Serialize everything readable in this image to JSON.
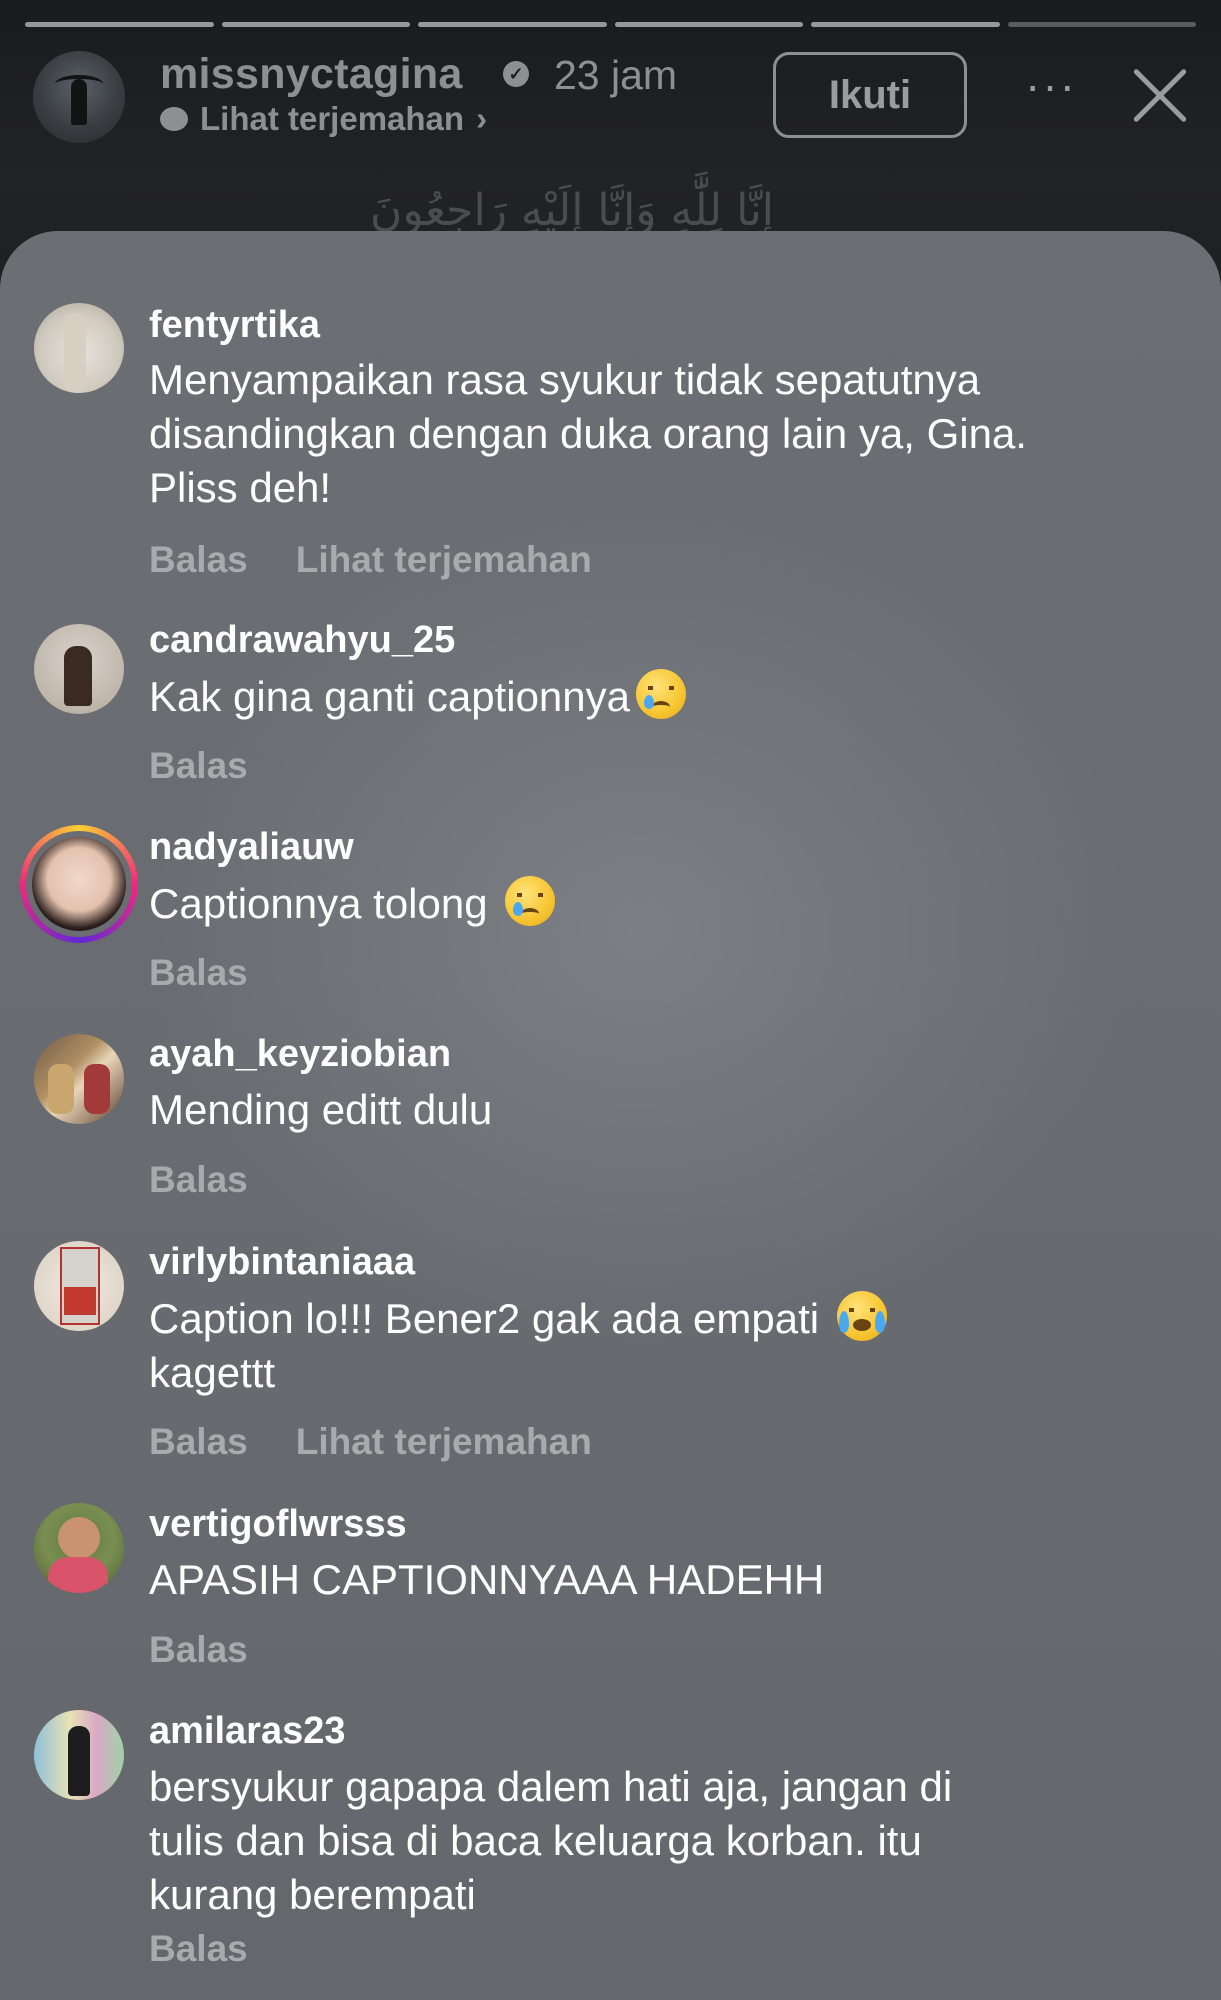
{
  "story": {
    "username": "missnyctagina",
    "time": "23 jam",
    "translate_label": "Lihat terjemahan",
    "follow_label": "Ikuti",
    "more_label": "···",
    "caption_arabic": "إِنَّا لِلَّٰهِ وَإِنَّا إِلَيْهِ رَاجِعُونَ",
    "progress_segments": 6
  },
  "comments": [
    {
      "username": "fentyrtika",
      "text": "Menyampaikan rasa syukur tidak sepatutnya disandingkan dengan duka orang lain ya, Gina. Pliss deh!",
      "reply": "Balas",
      "translate": "Lihat terjemahan"
    },
    {
      "username": "candrawahyu_25",
      "text": "Kak gina ganti captionnya",
      "emoji": "crying-face",
      "reply": "Balas"
    },
    {
      "username": "nadyaliauw",
      "text": "Captionnya tolong ",
      "emoji": "crying-face",
      "reply": "Balas"
    },
    {
      "username": "ayah_keyziobian",
      "text": "Mending editt dulu",
      "reply": "Balas"
    },
    {
      "username": "virlybintaniaaa",
      "text": "Caption lo!!! Bener2 gak ada empati ",
      "text2": "kagettt",
      "emoji": "loudly-crying-face",
      "reply": "Balas",
      "translate": "Lihat terjemahan"
    },
    {
      "username": "vertigoflwrsss",
      "text": "APASIH CAPTIONNYAAA HADEHH",
      "reply": "Balas"
    },
    {
      "username": "amilaras23",
      "text": "bersyukur gapapa dalem hati aja, jangan di tulis dan bisa di baca keluarga korban. itu kurang berempati",
      "reply": "Balas"
    }
  ]
}
